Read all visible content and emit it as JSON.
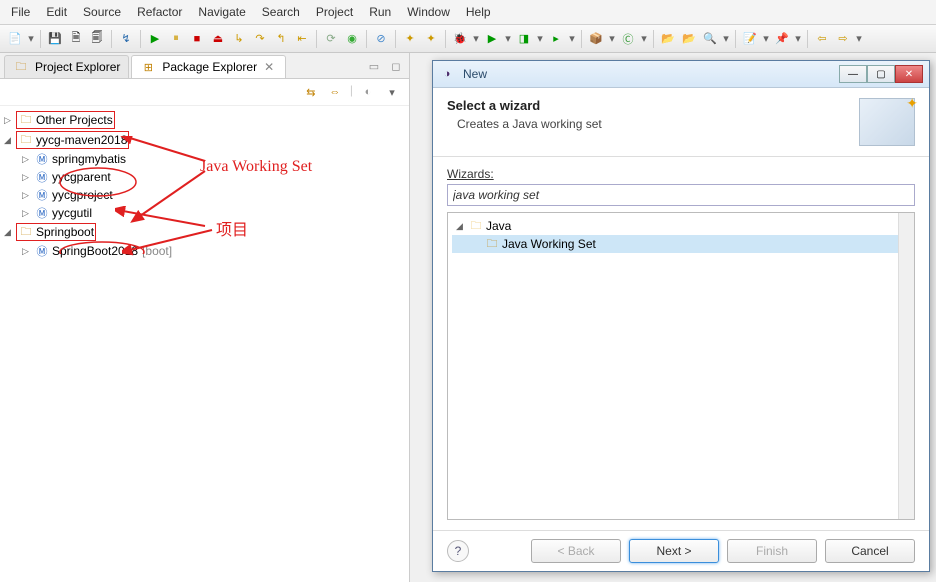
{
  "menu": [
    "File",
    "Edit",
    "Source",
    "Refactor",
    "Navigate",
    "Search",
    "Project",
    "Run",
    "Window",
    "Help"
  ],
  "tabs": {
    "project_explorer": "Project Explorer",
    "package_explorer": "Package Explorer"
  },
  "tree": {
    "other_projects": "Other Projects",
    "ws1": "yycg-maven2018",
    "ws1_children": [
      "springmybatis",
      "yycgparent",
      "yycgproject",
      "yycgutil"
    ],
    "ws2": "Springboot",
    "ws2_child": "SpringBoot2018",
    "ws2_child_decor": "[boot]"
  },
  "annotations": {
    "jws": "Java Working Set",
    "proj": "项目"
  },
  "dialog": {
    "title": "New",
    "header": "Select a wizard",
    "subheader": "Creates a Java working set",
    "wizards_label": "Wizards:",
    "filter_value": "java working set",
    "tree_folder": "Java",
    "tree_item": "Java Working Set",
    "back": "< Back",
    "next": "Next >",
    "finish": "Finish",
    "cancel": "Cancel"
  }
}
